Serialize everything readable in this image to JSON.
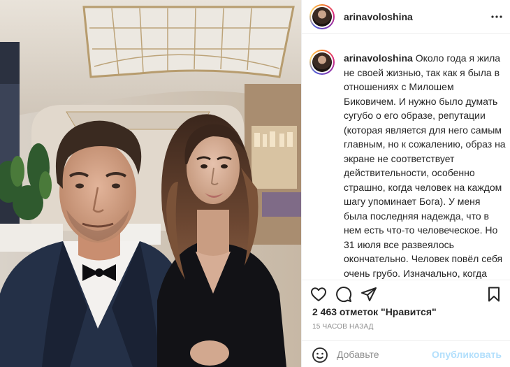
{
  "post": {
    "username": "arinavoloshina",
    "caption_text": "Около года я жила не своей жизнью, так как я была в отношениях с Милошем Биковичем. И нужно было думать сугубо о его образе, репутации (которая является для него самым главным, но к сожалению, образ на экране не соответствует действительности, особенно страшно, когда человек на каждом шагу упоминает Бога). У меня была последняя надежда, что в нем есть что-то человеческое. Но 31 июля все развеялось окончательно. Человек повёл себя очень грубо. Изначально, когда появилась информация, что мы вместе, я сразу предложила, давай я скажу, что я не имею к тебе никакого отношения, чтобы не было проблем. На что Милош сказал: «Нет, ты что, это",
    "likes": "2 463 отметок \"Нравится\"",
    "time_ago": "15 ЧАСОВ НАЗАД"
  },
  "icons": {
    "more": "more-horizontal-icon",
    "like": "heart-icon",
    "comment": "comment-bubble-icon",
    "share": "paper-plane-icon",
    "save": "bookmark-icon",
    "emoji": "emoji-smile-icon"
  },
  "comment": {
    "placeholder": "Добавьте",
    "publish_label": "Опубликовать"
  },
  "colors": {
    "text": "#262626",
    "muted": "#8e8e8e",
    "border": "#efefef",
    "publish_disabled": "#b2dffc"
  }
}
